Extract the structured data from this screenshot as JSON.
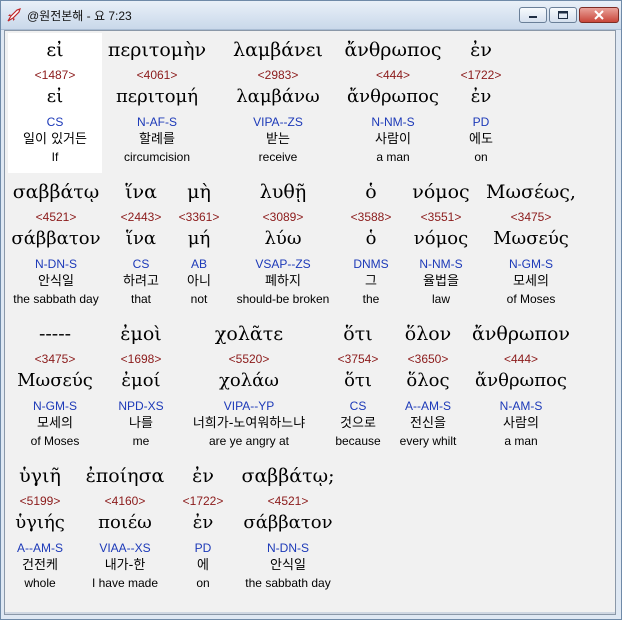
{
  "window": {
    "title": "@원전본해 - 요 7:23",
    "icon": "rocket-app-icon",
    "buttons": [
      "minimize-icon",
      "maximize-icon",
      "close-icon"
    ]
  },
  "rows": [
    [
      {
        "greek": "εἰ",
        "strongs": "<1487>",
        "lemma": "εἰ",
        "parse": "CS",
        "korean": "일이 있거든",
        "english": "If"
      },
      {
        "greek": "περιτομὴν",
        "strongs": "<4061>",
        "lemma": "περιτομή",
        "parse": "N-AF-S",
        "korean": "할례를",
        "english": "circumcision"
      },
      {
        "greek": "λαμβάνει",
        "strongs": "<2983>",
        "lemma": "λαμβάνω",
        "parse": "VIPA--ZS",
        "korean": "받는",
        "english": "receive"
      },
      {
        "greek": "ἄνθρωπος",
        "strongs": "<444>",
        "lemma": "ἄνθρωπος",
        "parse": "N-NM-S",
        "korean": "사람이",
        "english": "a man"
      },
      {
        "greek": "ἐν",
        "strongs": "<1722>",
        "lemma": "ἐν",
        "parse": "PD",
        "korean": "에도",
        "english": "on"
      }
    ],
    [
      {
        "greek": "σαββάτῳ",
        "strongs": "<4521>",
        "lemma": "σάββατον",
        "parse": "N-DN-S",
        "korean": "안식일",
        "english": "the sabbath day"
      },
      {
        "greek": "ἵνα",
        "strongs": "<2443>",
        "lemma": "ἵνα",
        "parse": "CS",
        "korean": "하려고",
        "english": "that"
      },
      {
        "greek": "μὴ",
        "strongs": "<3361>",
        "lemma": "μή",
        "parse": "AB",
        "korean": "아니",
        "english": "not"
      },
      {
        "greek": "λυθῇ",
        "strongs": "<3089>",
        "lemma": "λύω",
        "parse": "VSAP--ZS",
        "korean": "폐하지",
        "english": "should-be broken"
      },
      {
        "greek": "ὁ",
        "strongs": "<3588>",
        "lemma": "ὁ",
        "parse": "DNMS",
        "korean": "그",
        "english": "the"
      },
      {
        "greek": "νόμος",
        "strongs": "<3551>",
        "lemma": "νόμος",
        "parse": "N-NM-S",
        "korean": "율법을",
        "english": "law"
      },
      {
        "greek": "Μωσέως,",
        "strongs": "<3475>",
        "lemma": "Μωσεύς",
        "parse": "N-GM-S",
        "korean": "모세의",
        "english": "of Moses"
      }
    ],
    [
      {
        "greek": "-----",
        "strongs": "<3475>",
        "lemma": "Μωσεύς",
        "parse": "N-GM-S",
        "korean": "모세의",
        "english": "of Moses"
      },
      {
        "greek": "ἐμοὶ",
        "strongs": "<1698>",
        "lemma": "ἐμοί",
        "parse": "NPD-XS",
        "korean": "나를",
        "english": "me"
      },
      {
        "greek": "χολᾶτε",
        "strongs": "<5520>",
        "lemma": "χολάω",
        "parse": "VIPA--YP",
        "korean": "너희가-노여워하느냐",
        "english": "are ye angry at"
      },
      {
        "greek": "ὅτι",
        "strongs": "<3754>",
        "lemma": "ὅτι",
        "parse": "CS",
        "korean": "것으로",
        "english": "because"
      },
      {
        "greek": "ὅλον",
        "strongs": "<3650>",
        "lemma": "ὅλος",
        "parse": "A--AM-S",
        "korean": "전신을",
        "english": "every whilt"
      },
      {
        "greek": "ἄνθρωπον",
        "strongs": "<444>",
        "lemma": "ἄνθρωπος",
        "parse": "N-AM-S",
        "korean": "사람의",
        "english": "a man"
      }
    ],
    [
      {
        "greek": "ὑγιῆ",
        "strongs": "<5199>",
        "lemma": "ὑγιής",
        "parse": "A--AM-S",
        "korean": "건전케",
        "english": "whole"
      },
      {
        "greek": "ἐποίησα",
        "strongs": "<4160>",
        "lemma": "ποιέω",
        "parse": "VIAA--XS",
        "korean": "내가-한",
        "english": "I have made"
      },
      {
        "greek": "ἐν",
        "strongs": "<1722>",
        "lemma": "ἐν",
        "parse": "PD",
        "korean": "에",
        "english": "on"
      },
      {
        "greek": "σαββάτῳ;",
        "strongs": "<4521>",
        "lemma": "σάββατον",
        "parse": "N-DN-S",
        "korean": "안식일",
        "english": "the sabbath day"
      }
    ]
  ],
  "selected_word": "0.0"
}
